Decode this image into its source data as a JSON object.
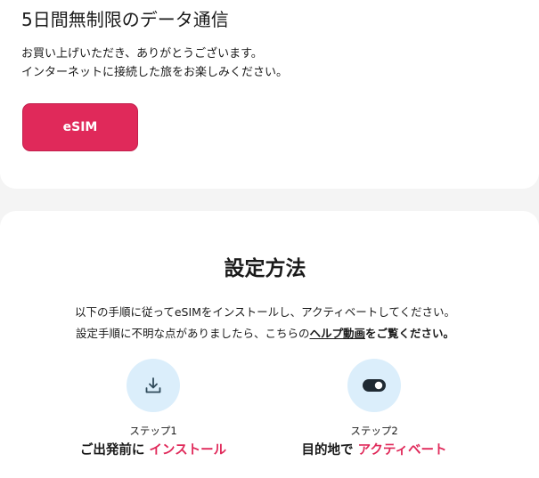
{
  "plan": {
    "title": "5日間無制限のデータ通信",
    "thanks_line1": "お買い上げいただき、ありがとうございます。",
    "thanks_line2": "インターネットに接続した旅をお楽しみください。",
    "esim_button_label": "eSIM"
  },
  "setup": {
    "title": "設定方法",
    "instruction_line1": "以下の手順に従ってeSIMをインストールし、アクティベートしてください。",
    "instruction_line2_prefix": "設定手順に不明な点がありましたら、こちらの",
    "help_link_label": "ヘルプ動画",
    "instruction_line2_suffix": "をご覧ください。",
    "steps": [
      {
        "label": "ステップ1",
        "title_prefix": "ご出発前に",
        "title_accent": "インストール",
        "icon": "download-icon"
      },
      {
        "label": "ステップ2",
        "title_prefix": "目的地で",
        "title_accent": "アクティベート",
        "icon": "toggle-icon"
      }
    ]
  },
  "colors": {
    "accent": "#e0295a",
    "icon_circle": "#dbeefb",
    "icon_stroke": "#2f4a5a"
  }
}
